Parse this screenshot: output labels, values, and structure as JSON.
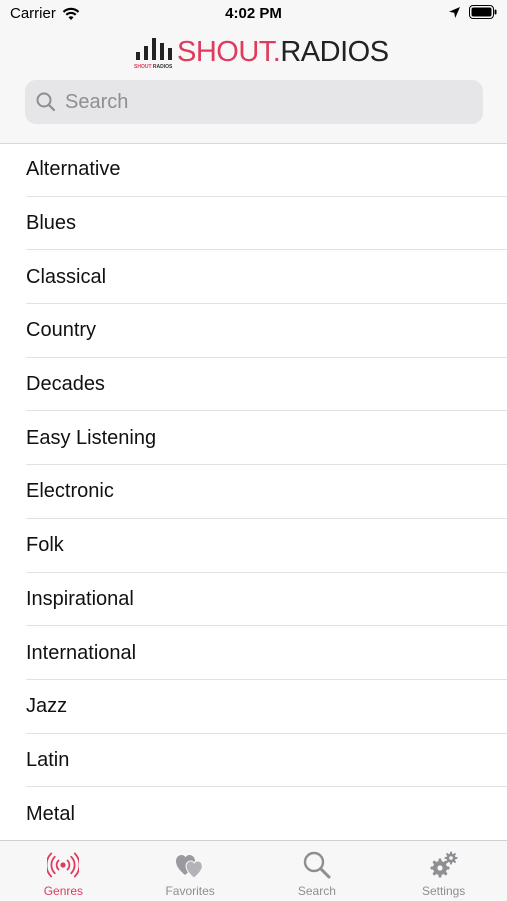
{
  "status_bar": {
    "carrier": "Carrier",
    "time": "4:02 PM"
  },
  "header": {
    "logo": {
      "shout": "SHOUT",
      "dot": ".",
      "radios": "RADIOS",
      "sub_shout": "SHOUT",
      "sub_radios": "RADIOS"
    },
    "search": {
      "placeholder": "Search"
    }
  },
  "genres": [
    "Alternative",
    "Blues",
    "Classical",
    "Country",
    "Decades",
    "Easy Listening",
    "Electronic",
    "Folk",
    "Inspirational",
    "International",
    "Jazz",
    "Latin",
    "Metal"
  ],
  "tabs": [
    {
      "label": "Genres",
      "icon": "radio-waves-icon",
      "active": true
    },
    {
      "label": "Favorites",
      "icon": "hearts-icon",
      "active": false
    },
    {
      "label": "Search",
      "icon": "search-icon",
      "active": false
    },
    {
      "label": "Settings",
      "icon": "gears-icon",
      "active": false
    }
  ],
  "colors": {
    "accent": "#e03a5c",
    "inactive": "#8e8e93",
    "bar_bg": "#f7f7f7"
  }
}
